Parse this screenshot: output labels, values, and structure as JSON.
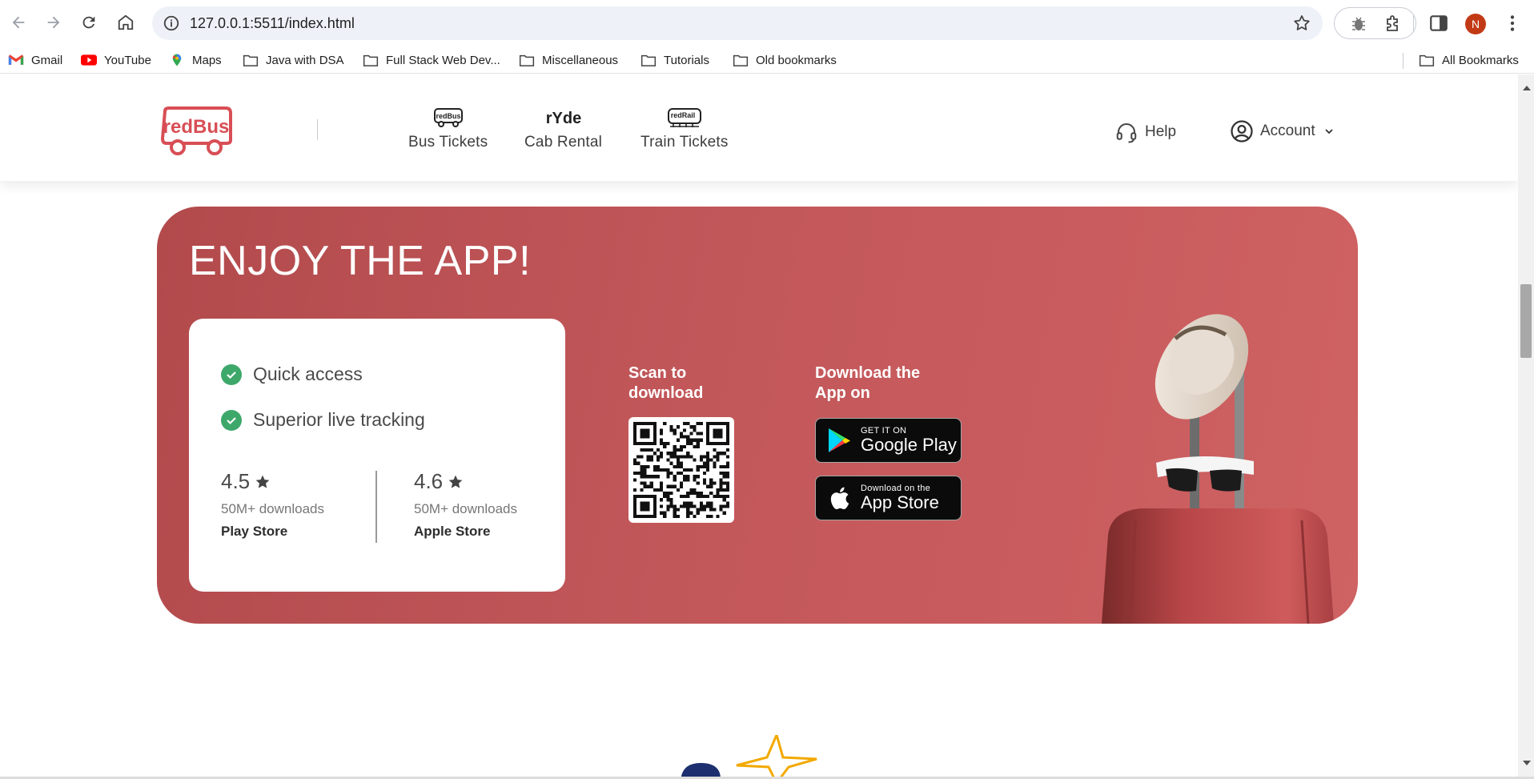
{
  "browser": {
    "url": "127.0.0.1:5511/index.html",
    "profile_initial": "N",
    "bookmarks": [
      {
        "label": "Gmail",
        "icon": "gmail-icon"
      },
      {
        "label": "YouTube",
        "icon": "youtube-icon"
      },
      {
        "label": "Maps",
        "icon": "maps-icon"
      },
      {
        "label": "Java with DSA",
        "icon": "folder-icon"
      },
      {
        "label": "Full Stack Web Dev...",
        "icon": "folder-icon"
      },
      {
        "label": "Miscellaneous",
        "icon": "folder-icon"
      },
      {
        "label": "Tutorials",
        "icon": "folder-icon"
      },
      {
        "label": "Old bookmarks",
        "icon": "folder-icon"
      }
    ],
    "all_bookmarks": "All Bookmarks"
  },
  "header": {
    "logo_text": "redBus",
    "nav": [
      {
        "label": "Bus Tickets",
        "logo_text": "redBus"
      },
      {
        "label": "Cab Rental",
        "logo_text": "rYde"
      },
      {
        "label": "Train Tickets",
        "logo_text": "redRail"
      }
    ],
    "help": "Help",
    "account": "Account"
  },
  "app_banner": {
    "title": "ENJOY THE APP!",
    "features": [
      "Quick access",
      "Superior live tracking"
    ],
    "ratings": [
      {
        "value": "4.5",
        "downloads": "50M+ downloads",
        "store": "Play Store"
      },
      {
        "value": "4.6",
        "downloads": "50M+ downloads",
        "store": "Apple Store"
      }
    ],
    "scan_label_line1": "Scan to",
    "scan_label_line2": "download",
    "download_label_line1": "Download the",
    "download_label_line2": "App on",
    "google_play": {
      "small": "GET IT ON",
      "big": "Google Play"
    },
    "app_store": {
      "small": "Download on the",
      "big": "App Store"
    }
  },
  "colors": {
    "brand_red": "#d84e55",
    "banner_red": "#c2575a",
    "check_green": "#3ea86b",
    "star_yellow": "#f4b400"
  }
}
